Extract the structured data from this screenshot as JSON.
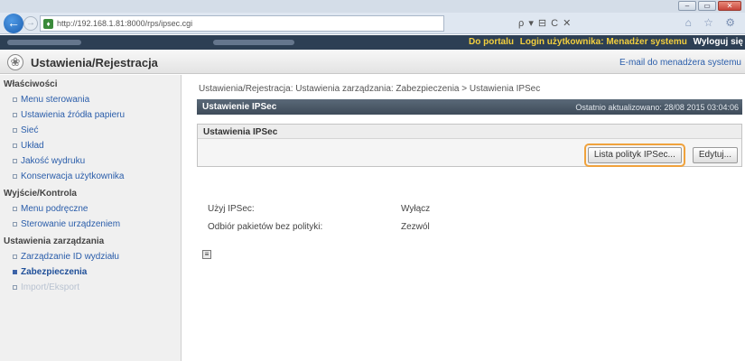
{
  "browser": {
    "url": "http://192.168.1.81:8000/rps/ipsec.cgi",
    "window_min": "–",
    "window_max": "▭",
    "window_close": "✕",
    "back_glyph": "←",
    "forward_glyph": "→",
    "url_icon_glyph": "♦",
    "search_controls": "ρ ▾ ⊟ C ✕",
    "toolbar_icons": "⌂ ☆ ⚙"
  },
  "topnav": {
    "portal_link": "Do portalu",
    "login_user": "Login użytkownika: Menadżer systemu",
    "logout": "Wyloguj się"
  },
  "header": {
    "logo_glyph": "❀",
    "title": "Ustawienia/Rejestracja",
    "email_link": "E-mail do menadżera systemu"
  },
  "sidebar": {
    "sections": [
      {
        "title": "Właściwości",
        "items": [
          {
            "label": "Menu sterowania"
          },
          {
            "label": "Ustawienia źródła papieru"
          },
          {
            "label": "Sieć"
          },
          {
            "label": "Układ"
          },
          {
            "label": "Jakość wydruku"
          },
          {
            "label": "Konserwacja użytkownika"
          }
        ]
      },
      {
        "title": "Wyjście/Kontrola",
        "items": [
          {
            "label": "Menu podręczne"
          },
          {
            "label": "Sterowanie urządzeniem"
          }
        ]
      },
      {
        "title": "Ustawienia zarządzania",
        "items": [
          {
            "label": "Zarządzanie ID wydziału"
          },
          {
            "label": "Zabezpieczenia"
          },
          {
            "label": "Import/Eksport"
          }
        ]
      }
    ]
  },
  "main": {
    "breadcrumb": "Ustawienia/Rejestracja: Ustawienia zarządzania: Zabezpieczenia > Ustawienia IPSec",
    "section_title": "Ustawienie IPSec",
    "last_updated": "Ostatnio aktualizowano: 28/08 2015 03:04:06",
    "box_title": "Ustawienia IPSec",
    "policy_list_button": "Lista polityk IPSec...",
    "edit_button": "Edytuj...",
    "rows": [
      {
        "label": "Użyj IPSec:",
        "value": "Wyłącz"
      },
      {
        "label": "Odbiór pakietów bez polityki:",
        "value": "Zezwól"
      }
    ],
    "print_icon_glyph": "≡"
  }
}
